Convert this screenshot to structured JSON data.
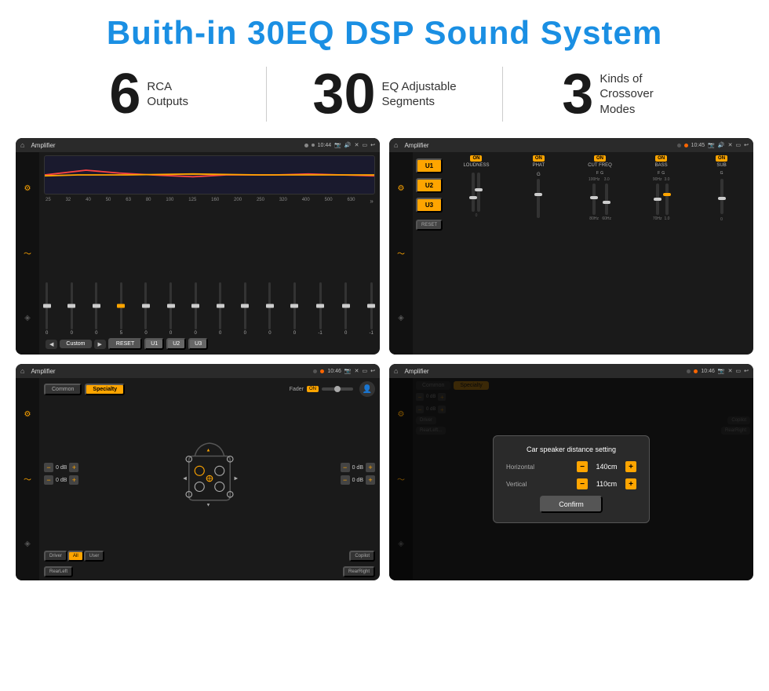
{
  "header": {
    "title": "Buith-in 30EQ DSP Sound System"
  },
  "stats": [
    {
      "number": "6",
      "label": "RCA\nOutputs"
    },
    {
      "number": "30",
      "label": "EQ Adjustable\nSegments"
    },
    {
      "number": "3",
      "label": "Kinds of\nCrossover Modes"
    }
  ],
  "screens": [
    {
      "id": "screen1",
      "topbar": {
        "app": "Amplifier",
        "time": "10:44"
      },
      "eq_freqs": [
        "25",
        "32",
        "40",
        "50",
        "63",
        "80",
        "100",
        "125",
        "160",
        "200",
        "250",
        "320",
        "400",
        "500",
        "630"
      ],
      "eq_values": [
        "0",
        "0",
        "0",
        "5",
        "0",
        "0",
        "0",
        "0",
        "0",
        "0",
        "0",
        "-1",
        "0",
        "-1",
        ""
      ],
      "bottom_buttons": [
        "◀",
        "Custom",
        "▶",
        "RESET",
        "U1",
        "U2",
        "U3"
      ]
    },
    {
      "id": "screen2",
      "topbar": {
        "app": "Amplifier",
        "time": "10:45"
      },
      "u_buttons": [
        "U1",
        "U2",
        "U3"
      ],
      "channels": [
        {
          "label": "LOUDNESS",
          "on": true
        },
        {
          "label": "PHAT",
          "on": true
        },
        {
          "label": "CUT FREQ",
          "on": true
        },
        {
          "label": "BASS",
          "on": true
        },
        {
          "label": "SUB",
          "on": true
        }
      ],
      "reset_label": "RESET"
    },
    {
      "id": "screen3",
      "topbar": {
        "app": "Amplifier",
        "time": "10:46"
      },
      "tabs": [
        "Common",
        "Specialty"
      ],
      "active_tab": "Specialty",
      "fader": {
        "label": "Fader",
        "on": true
      },
      "db_values": [
        "0 dB",
        "0 dB",
        "0 dB",
        "0 dB"
      ],
      "buttons": [
        "Driver",
        "RearLeft",
        "All",
        "User",
        "RearRight",
        "Copilot"
      ]
    },
    {
      "id": "screen4",
      "topbar": {
        "app": "Amplifier",
        "time": "10:46"
      },
      "tabs": [
        "Common",
        "Specialty"
      ],
      "dialog": {
        "title": "Car speaker distance setting",
        "fields": [
          {
            "label": "Horizontal",
            "value": "140cm"
          },
          {
            "label": "Vertical",
            "value": "110cm"
          }
        ],
        "confirm_label": "Confirm"
      },
      "db_values": [
        "0 dB",
        "0 dB"
      ],
      "buttons": [
        "Driver",
        "RearLeft...",
        "Copilot",
        "RearRight"
      ]
    }
  ],
  "colors": {
    "accent": "#ffa500",
    "blue_title": "#1a8fe3",
    "dark_bg": "#1a1a1a",
    "card_bg": "#2a2a2a"
  }
}
